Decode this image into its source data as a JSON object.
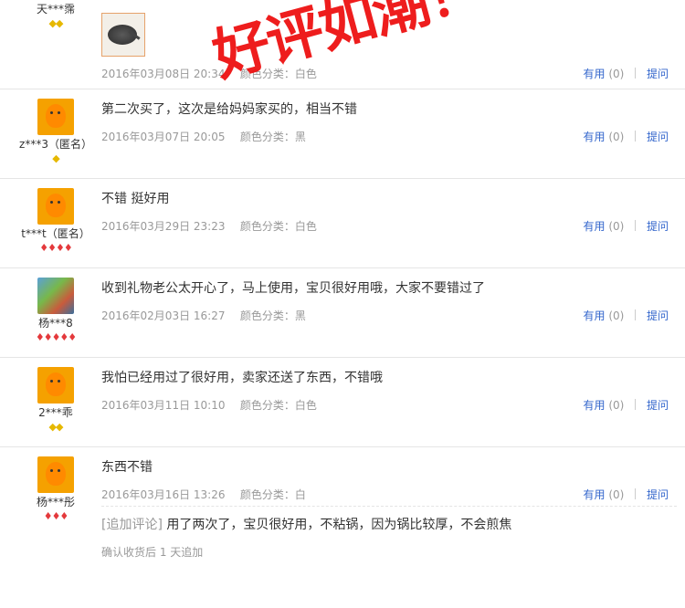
{
  "reviews": [
    {
      "user": "天***霈",
      "rank": "◆◆",
      "rank_color": "gold",
      "avatar": "dark",
      "text": "",
      "has_image": true,
      "date": "2016年03月08日 20:34",
      "spec": "颜色分类：白色",
      "useful_label": "有用",
      "useful_count": "(0)",
      "ask_label": "提问"
    },
    {
      "user": "z***3（匿名）",
      "rank": "◆",
      "rank_color": "gold",
      "avatar": "orange",
      "text": "第二次买了，这次是给妈妈家买的，相当不错",
      "date": "2016年03月07日 20:05",
      "spec": "颜色分类：黑",
      "useful_label": "有用",
      "useful_count": "(0)",
      "ask_label": "提问"
    },
    {
      "user": "t***t（匿名）",
      "rank": "♦♦♦♦",
      "rank_color": "red",
      "avatar": "orange",
      "text": "不错 挺好用",
      "date": "2016年03月29日 23:23",
      "spec": "颜色分类：白色",
      "useful_label": "有用",
      "useful_count": "(0)",
      "ask_label": "提问"
    },
    {
      "user": "杨***8",
      "rank": "♦♦♦♦♦",
      "rank_color": "red",
      "avatar": "photo",
      "text": "收到礼物老公太开心了，马上使用，宝贝很好用哦，大家不要错过了",
      "date": "2016年02月03日 16:27",
      "spec": "颜色分类：黑",
      "useful_label": "有用",
      "useful_count": "(0)",
      "ask_label": "提问"
    },
    {
      "user": "2***乖",
      "rank": "◆◆",
      "rank_color": "gold",
      "avatar": "orange",
      "text": "我怕已经用过了很好用，卖家还送了东西，不错哦",
      "date": "2016年03月11日 10:10",
      "spec": "颜色分类：白色",
      "useful_label": "有用",
      "useful_count": "(0)",
      "ask_label": "提问"
    },
    {
      "user": "杨***彤",
      "rank": "♦♦♦",
      "rank_color": "red",
      "avatar": "orange",
      "text": "东西不错",
      "date": "2016年03月16日 13:26",
      "spec": "颜色分类：白",
      "useful_label": "有用",
      "useful_count": "(0)",
      "ask_label": "提问",
      "append_tag": "[追加评论]",
      "append_text": " 用了两次了，宝贝很好用，不粘锅，因为锅比较厚，不会煎焦",
      "append_note": "确认收货后 1 天追加"
    }
  ],
  "stamp_text": "好评如潮！"
}
